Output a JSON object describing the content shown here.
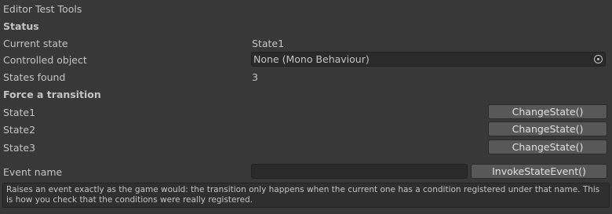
{
  "header": {
    "title": "Editor Test Tools"
  },
  "status": {
    "heading": "Status",
    "current_state_label": "Current state",
    "current_state_value": "State1",
    "controlled_object_label": "Controlled object",
    "controlled_object_value": "None (Mono Behaviour)",
    "states_found_label": "States found",
    "states_found_value": "3"
  },
  "force": {
    "heading": "Force a transition",
    "states": [
      {
        "label": "State1",
        "button": "ChangeState()"
      },
      {
        "label": "State2",
        "button": "ChangeState()"
      },
      {
        "label": "State3",
        "button": "ChangeState()"
      }
    ]
  },
  "event": {
    "label": "Event name",
    "value": "",
    "button": "InvokeStateEvent()"
  },
  "help": {
    "text": "Raises an event exactly as the game would: the transition only happens when the current one has a condition registered under that name. This is how you check that the conditions were really registered."
  }
}
